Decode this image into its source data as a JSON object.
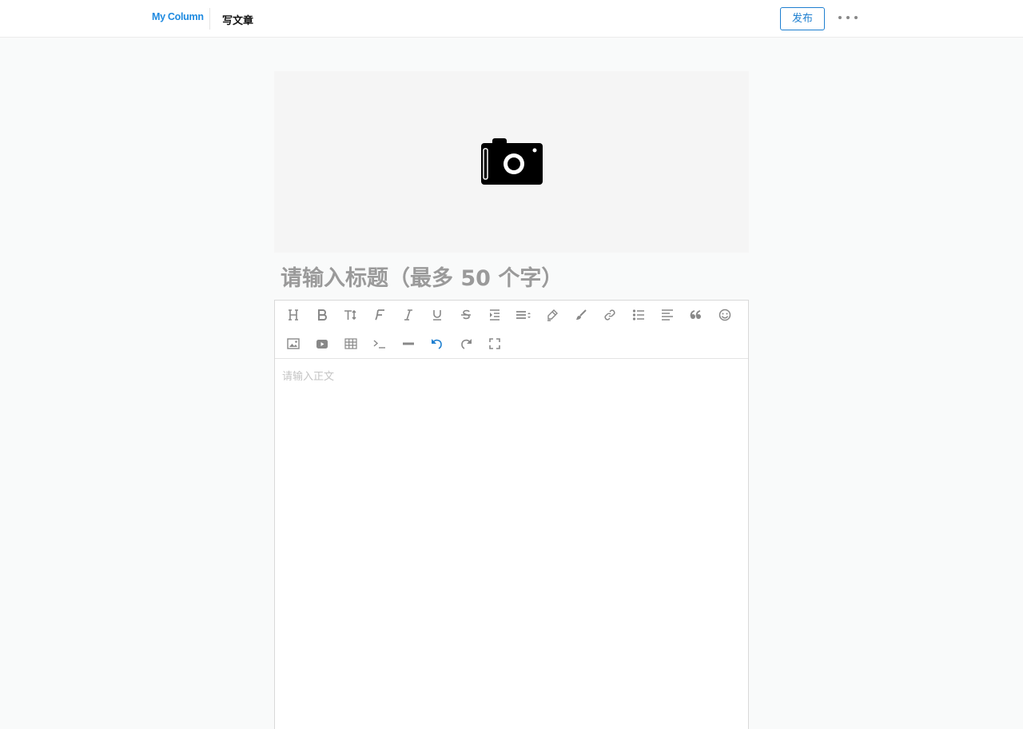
{
  "header": {
    "logo": "My Column",
    "page_title": "写文章",
    "publish_label": "发布"
  },
  "cover": {
    "icon": "camera-icon"
  },
  "editor": {
    "title_placeholder": "请输入标题（最多 50 个字）",
    "body_placeholder": "请输入正文"
  },
  "toolbar": {
    "row1": [
      "heading-icon",
      "bold-icon",
      "font-size-icon",
      "font-family-icon",
      "italic-icon",
      "underline-icon",
      "strikethrough-icon",
      "indent-icon",
      "line-height-icon",
      "highlighter-icon",
      "brush-icon",
      "link-icon",
      "bullet-list-icon",
      "align-left-icon",
      "quote-icon",
      "emoji-icon"
    ],
    "row2": [
      "image-icon",
      "video-icon",
      "table-icon",
      "code-icon",
      "horizontal-rule-icon",
      "undo-icon",
      "redo-icon",
      "fullscreen-icon"
    ]
  },
  "colors": {
    "accent": "#1e7fd0",
    "logo": "#1e8ae0",
    "icon": "#888888",
    "active_icon": "#1e7fd0"
  }
}
